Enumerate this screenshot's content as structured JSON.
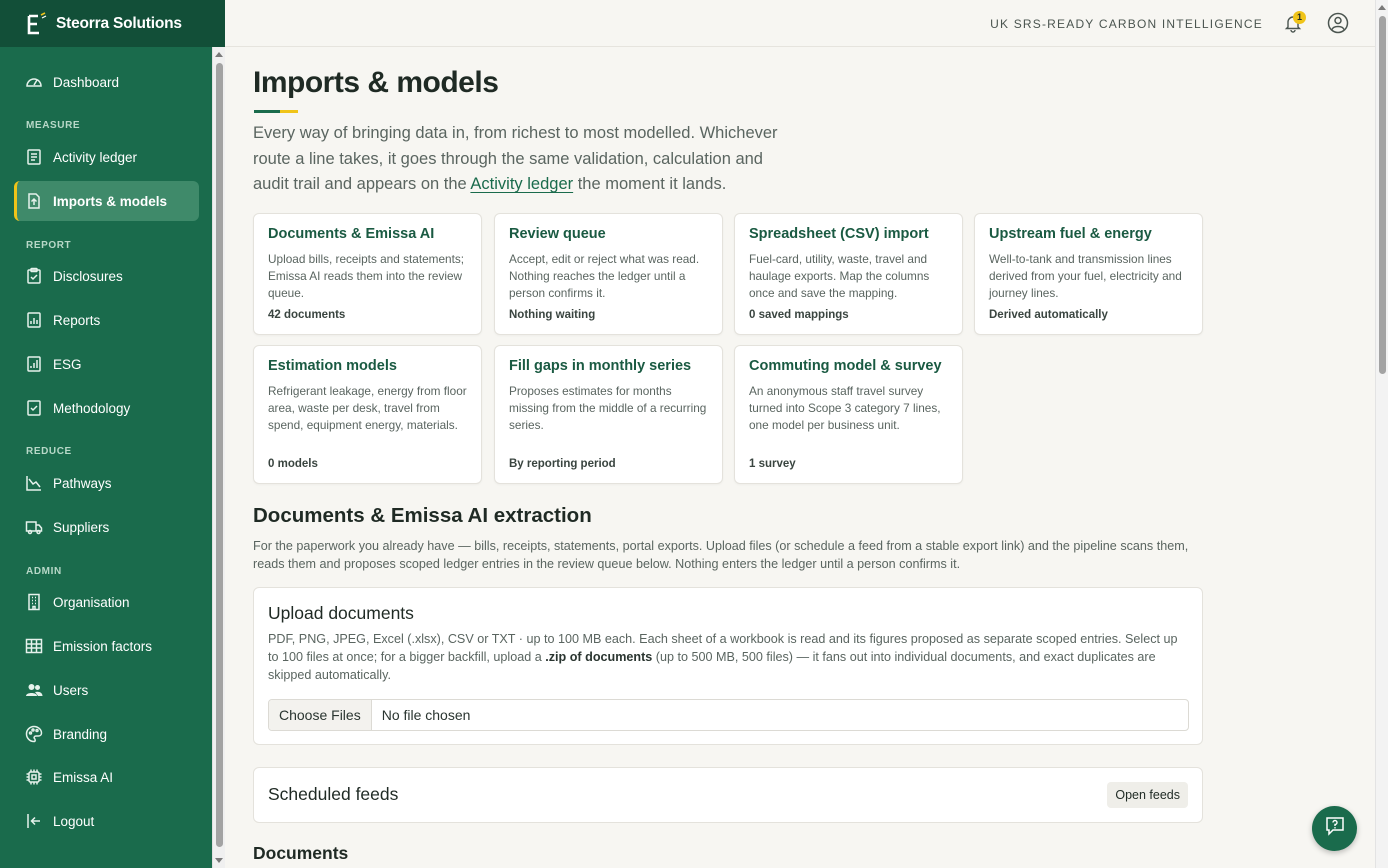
{
  "brand": {
    "name": "Steorra Solutions"
  },
  "sidebar": {
    "items": [
      {
        "label": "Dashboard",
        "icon": "gauge-icon"
      },
      {
        "label": "Activity ledger",
        "icon": "ledger-icon"
      },
      {
        "label": "Imports & models",
        "icon": "upload-doc-icon"
      },
      {
        "label": "Disclosures",
        "icon": "clipboard-icon"
      },
      {
        "label": "Reports",
        "icon": "bar-chart-icon"
      },
      {
        "label": "ESG",
        "icon": "building-chart-icon"
      },
      {
        "label": "Methodology",
        "icon": "checklist-icon"
      },
      {
        "label": "Pathways",
        "icon": "trend-down-icon"
      },
      {
        "label": "Suppliers",
        "icon": "truck-icon"
      },
      {
        "label": "Organisation",
        "icon": "office-icon"
      },
      {
        "label": "Emission factors",
        "icon": "table-icon"
      },
      {
        "label": "Users",
        "icon": "users-icon"
      },
      {
        "label": "Branding",
        "icon": "palette-icon"
      },
      {
        "label": "Emissa AI",
        "icon": "chip-icon"
      },
      {
        "label": "Logout",
        "icon": "logout-icon"
      }
    ],
    "sections": {
      "measure": "MEASURE",
      "report": "REPORT",
      "reduce": "REDUCE",
      "admin": "ADMIN"
    }
  },
  "topbar": {
    "tag": "UK SRS-READY CARBON INTELLIGENCE",
    "notifications": "1"
  },
  "page": {
    "title": "Imports & models",
    "intro_before": "Every way of bringing data in, from richest to most modelled. Whichever route a line takes, it goes through the same validation, calculation and audit trail and appears on the ",
    "intro_link": "Activity ledger",
    "intro_after": " the moment it lands."
  },
  "cards": [
    {
      "title": "Documents & Emissa AI",
      "desc": "Upload bills, receipts and statements; Emissa AI reads them into the review queue.",
      "meta": "42 documents"
    },
    {
      "title": "Review queue",
      "desc": "Accept, edit or reject what was read. Nothing reaches the ledger until a person confirms it.",
      "meta": "Nothing waiting"
    },
    {
      "title": "Spreadsheet (CSV) import",
      "desc": "Fuel-card, utility, waste, travel and haulage exports. Map the columns once and save the mapping.",
      "meta": "0 saved mappings"
    },
    {
      "title": "Upstream fuel & energy",
      "desc": "Well-to-tank and transmission lines derived from your fuel, electricity and journey lines.",
      "meta": "Derived automatically"
    },
    {
      "title": "Estimation models",
      "desc": "Refrigerant leakage, energy from floor area, waste per desk, travel from spend, equipment energy, materials.",
      "meta": "0 models"
    },
    {
      "title": "Fill gaps in monthly series",
      "desc": "Proposes estimates for months missing from the middle of a recurring series.",
      "meta": "By reporting period"
    },
    {
      "title": "Commuting model & survey",
      "desc": "An anonymous staff travel survey turned into Scope 3 category 7 lines, one model per business unit.",
      "meta": "1 survey"
    }
  ],
  "extraction": {
    "title": "Documents & Emissa AI extraction",
    "desc": "For the paperwork you already have — bills, receipts, statements, portal exports. Upload files (or schedule a feed from a stable export link) and the pipeline scans them, reads them and proposes scoped ledger entries in the review queue below. Nothing enters the ledger until a person confirms it."
  },
  "upload": {
    "title": "Upload documents",
    "desc_before": "PDF, PNG, JPEG, Excel (.xlsx), CSV or TXT · up to 100 MB each. Each sheet of a workbook is read and its figures proposed as separate scoped entries. Select up to 100 files at once; for a bigger backfill, upload a ",
    "desc_bold": ".zip of documents",
    "desc_after": " (up to 500 MB, 500 files) — it fans out into individual documents, and exact duplicates are skipped automatically.",
    "choose_label": "Choose Files",
    "file_status": "No file chosen"
  },
  "feeds": {
    "title": "Scheduled feeds",
    "button": "Open feeds"
  },
  "documents": {
    "title": "Documents"
  },
  "colors": {
    "sidebar": "#1a6b4c",
    "sidebar_header": "#124f38",
    "accent": "#f0c419",
    "card_title": "#1a5a42"
  }
}
